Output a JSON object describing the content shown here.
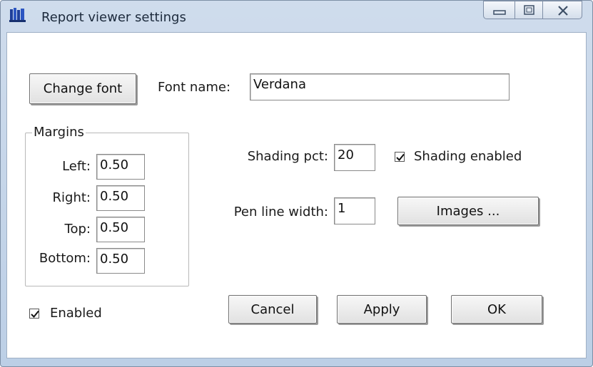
{
  "window": {
    "title": "Report viewer settings",
    "icon": "app-icon",
    "controls": {
      "minimize": "minimize-icon",
      "maximize": "maximize-icon",
      "close": "close-icon"
    }
  },
  "font": {
    "button_label": "Change font",
    "name_label": "Font name:",
    "name_value": "Verdana"
  },
  "margins": {
    "legend": "Margins",
    "fields": [
      {
        "label": "Left:",
        "value": "0.50"
      },
      {
        "label": "Right:",
        "value": "0.50"
      },
      {
        "label": "Top:",
        "value": "0.50"
      },
      {
        "label": "Bottom:",
        "value": "0.50"
      }
    ]
  },
  "shading": {
    "pct_label": "Shading pct:",
    "pct_value": "20",
    "enabled_label": "Shading enabled",
    "enabled_checked": true
  },
  "pen": {
    "label": "Pen line width:",
    "value": "1"
  },
  "images_button": "Images ...",
  "enabled": {
    "label": "Enabled",
    "checked": true
  },
  "actions": {
    "cancel": "Cancel",
    "apply": "Apply",
    "ok": "OK"
  }
}
